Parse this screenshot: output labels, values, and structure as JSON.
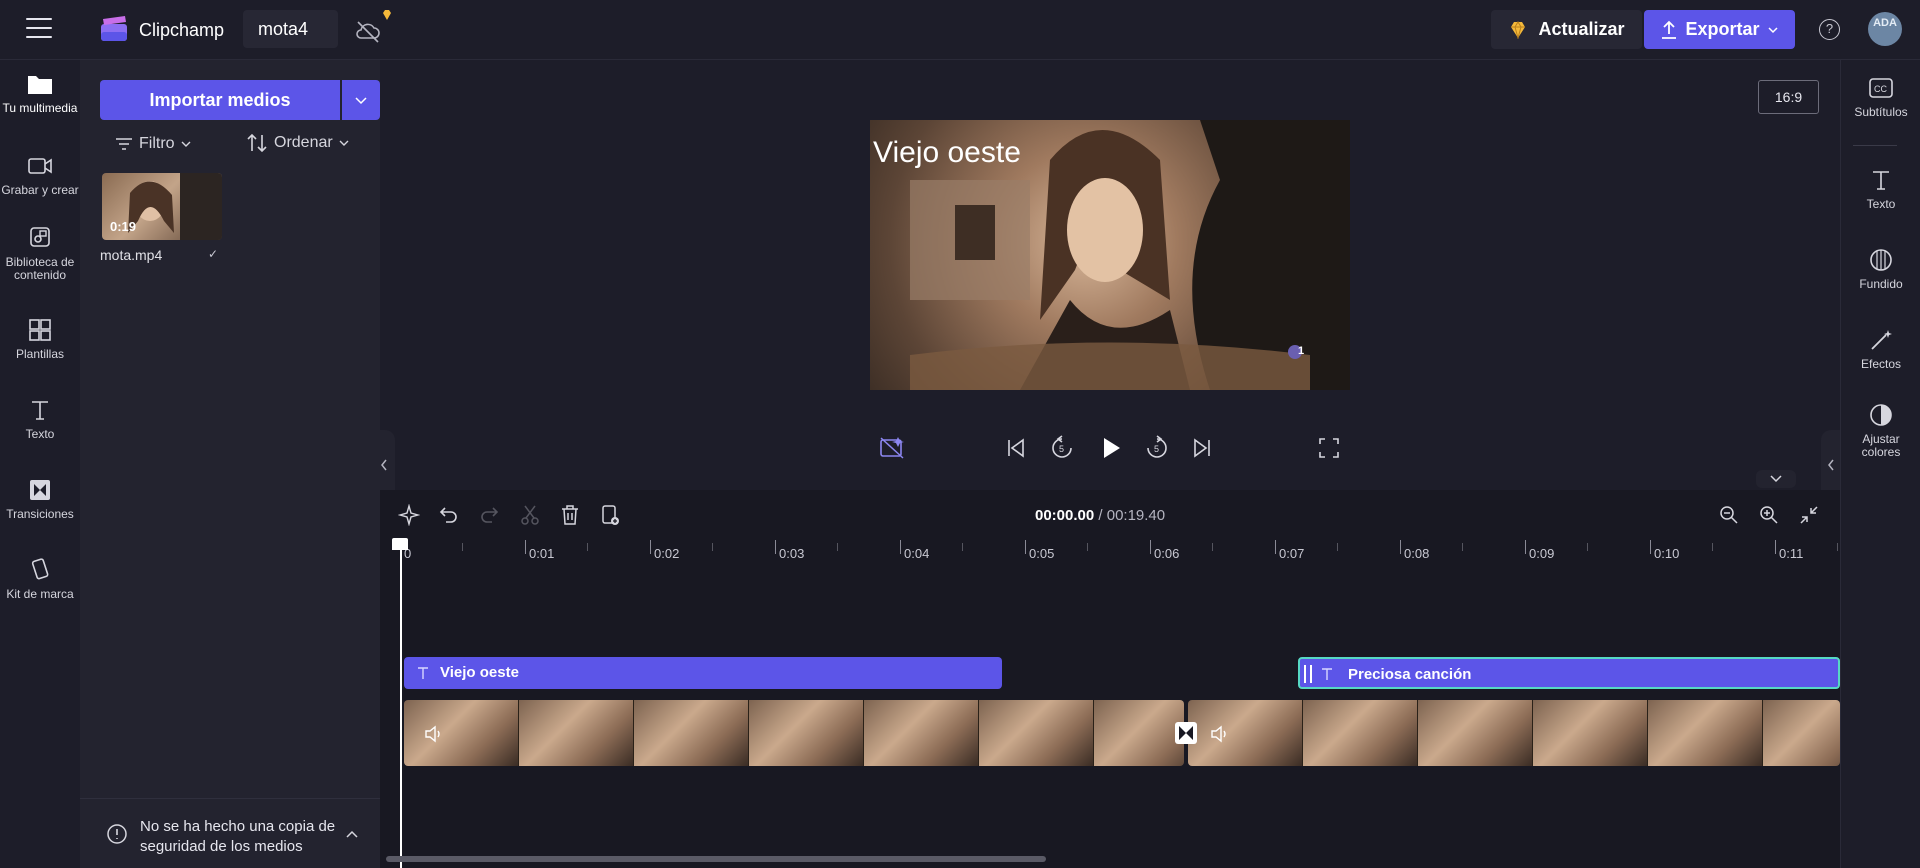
{
  "app": {
    "name": "Clipchamp",
    "project_name": "mota4"
  },
  "header": {
    "upgrade_label": "Actualizar",
    "export_label": "Exportar",
    "help_glyph": "?",
    "avatar_initials": "ADA"
  },
  "leftnav": {
    "items": [
      {
        "label": "Tu multimedia",
        "icon": "folder-icon"
      },
      {
        "label": "Grabar y crear",
        "icon": "camera-icon"
      },
      {
        "label": "Biblioteca de contenido",
        "icon": "library-icon"
      },
      {
        "label": "Plantillas",
        "icon": "templates-icon"
      },
      {
        "label": "Texto",
        "icon": "text-icon"
      },
      {
        "label": "Transiciones",
        "icon": "transitions-icon"
      },
      {
        "label": "Kit de marca",
        "icon": "brand-kit-icon"
      }
    ]
  },
  "media": {
    "import_label": "Importar medios",
    "filter_label": "Filtro",
    "sort_label": "Ordenar",
    "items": [
      {
        "name": "mota.mp4",
        "duration": "0:19"
      }
    ],
    "backup_notice": "No se ha hecho una copia de seguridad de los medios"
  },
  "preview": {
    "aspect_ratio": "16:9",
    "overlay_title": "Viejo oeste",
    "badge_number": "1"
  },
  "rightnav": {
    "items": [
      {
        "label": "Subtítulos",
        "icon": "captions-icon"
      },
      {
        "label": "Texto",
        "icon": "text-icon"
      },
      {
        "label": "Fundido",
        "icon": "fade-icon"
      },
      {
        "label": "Efectos",
        "icon": "effects-icon"
      },
      {
        "label": "Ajustar colores",
        "icon": "adjust-colors-icon"
      }
    ]
  },
  "timeline": {
    "current_time": "00:00.00",
    "total_time": "/ 00:19.40",
    "ruler_labels": [
      "0",
      "0:01",
      "0:02",
      "0:03",
      "0:04",
      "0:05",
      "0:06",
      "0:07",
      "0:08",
      "0:09",
      "0:10",
      "0:11"
    ],
    "text_clips": [
      {
        "label": "Viejo oeste"
      },
      {
        "label": "Preciosa canción"
      }
    ]
  },
  "colors": {
    "accent": "#5c55e8",
    "selection": "#56d8c4",
    "background": "#1d1d29"
  }
}
